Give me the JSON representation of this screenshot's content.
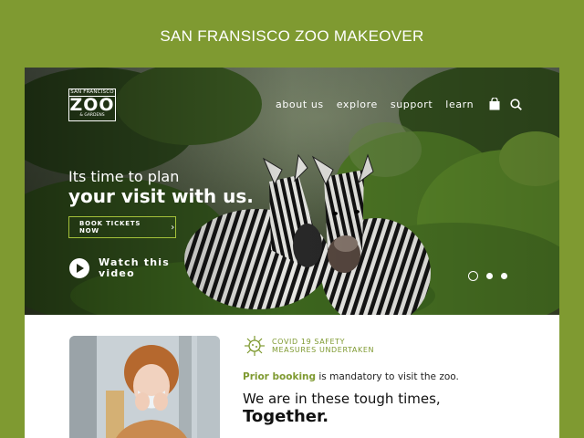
{
  "page": {
    "heading": "SAN FRANSISCO ZOO MAKEOVER"
  },
  "logo": {
    "top": "SAN FRANCISCO",
    "main": "ZOO",
    "bottom": "& GARDENS"
  },
  "nav": {
    "items": [
      "about us",
      "explore",
      "support",
      "learn"
    ]
  },
  "hero": {
    "headline_line1": "Its time to plan",
    "headline_line2": "your visit with us.",
    "cta_label": "BOOK TICKETS NOW",
    "watch_label": "Watch this video",
    "carousel": {
      "slides": 3,
      "active": 1
    }
  },
  "covid": {
    "title_line1": "COVID 19 SAFETY",
    "title_line2": "MEASURES UNDERTAKEN",
    "prior_highlight": "Prior booking",
    "prior_rest": " is mandatory to visit the zoo.",
    "line1": "We are in these tough times,",
    "line2": "Together."
  },
  "colors": {
    "accent": "#7f9a31",
    "button_border": "#a4c13a"
  }
}
